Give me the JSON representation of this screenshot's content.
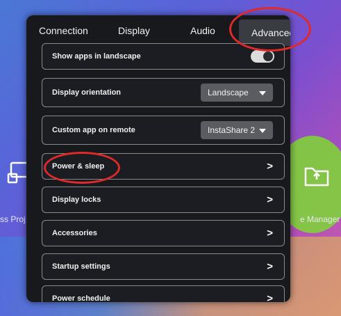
{
  "desktop": {
    "left_label": "ss Proj",
    "right_label": "e Manager"
  },
  "tabs": [
    {
      "label": "Connection"
    },
    {
      "label": "Display"
    },
    {
      "label": "Audio"
    },
    {
      "label": "Advanced",
      "selected": true
    }
  ],
  "settings": {
    "show_apps_landscape": {
      "label": "Show apps in landscape",
      "toggle_on": true
    },
    "display_orientation": {
      "label": "Display orientation",
      "value": "Landscape"
    },
    "custom_app_on_remote": {
      "label": "Custom app on remote",
      "value": "InstaShare 2"
    },
    "power_sleep": {
      "label": "Power & sleep"
    },
    "display_locks": {
      "label": "Display locks"
    },
    "accessories": {
      "label": "Accessories"
    },
    "startup_settings": {
      "label": "Startup settings"
    },
    "power_schedule": {
      "label": "Power schedule"
    }
  },
  "colors": {
    "panel": "#18191d",
    "highlight_circle": "#e02a2a",
    "row_border": "#8a8b90"
  }
}
